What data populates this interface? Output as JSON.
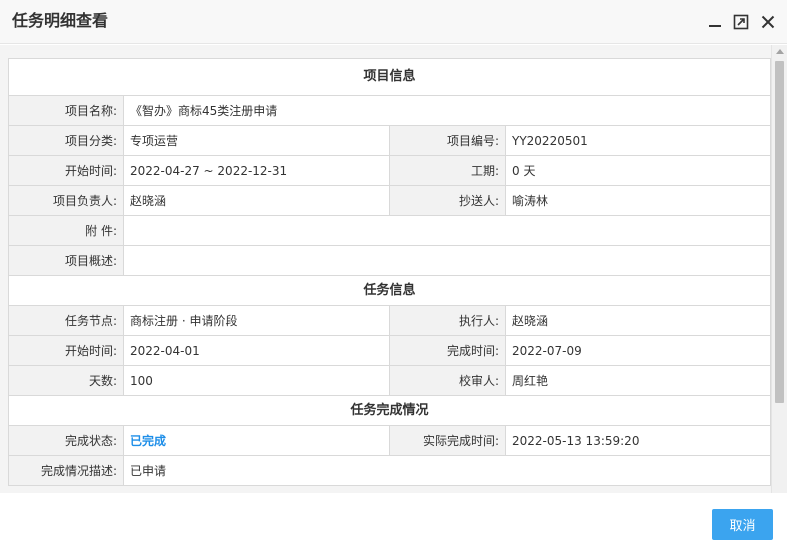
{
  "window": {
    "title": "任务明细查看"
  },
  "project": {
    "section_title": "项目信息",
    "name_label": "项目名称:",
    "name_value": "《智办》商标45类注册申请",
    "category_label": "项目分类:",
    "category_value": "专项运营",
    "code_label": "项目编号:",
    "code_value": "YY20220501",
    "start_label": "开始时间:",
    "start_value": "2022-04-27 ~ 2022-12-31",
    "period_label": "工期:",
    "period_value": "0 天",
    "owner_label": "项目负责人:",
    "owner_value": "赵晓涵",
    "cc_label": "抄送人:",
    "cc_value": "喻涛林",
    "attachment_label": "附 件:",
    "attachment_value": "",
    "overview_label": "项目概述:",
    "overview_value": ""
  },
  "task": {
    "section_title": "任务信息",
    "node_label": "任务节点:",
    "node_value": "商标注册 · 申请阶段",
    "executor_label": "执行人:",
    "executor_value": "赵晓涵",
    "start_label": "开始时间:",
    "start_value": "2022-04-01",
    "finish_label": "完成时间:",
    "finish_value": "2022-07-09",
    "days_label": "天数:",
    "days_value": "100",
    "reviewer_label": "校审人:",
    "reviewer_value": "周红艳"
  },
  "completion": {
    "section_title": "任务完成情况",
    "status_label": "完成状态:",
    "status_value": "已完成",
    "status_color": "#1e8ee8",
    "actual_label": "实际完成时间:",
    "actual_value": "2022-05-13 13:59:20",
    "desc_label": "完成情况描述:",
    "desc_value": "已申请"
  },
  "footer": {
    "cancel_label": "取消",
    "cancel_color": "#3ba4ef"
  },
  "icons": {
    "minimize": "minimize-icon",
    "maximize": "maximize-icon",
    "close": "close-icon"
  }
}
